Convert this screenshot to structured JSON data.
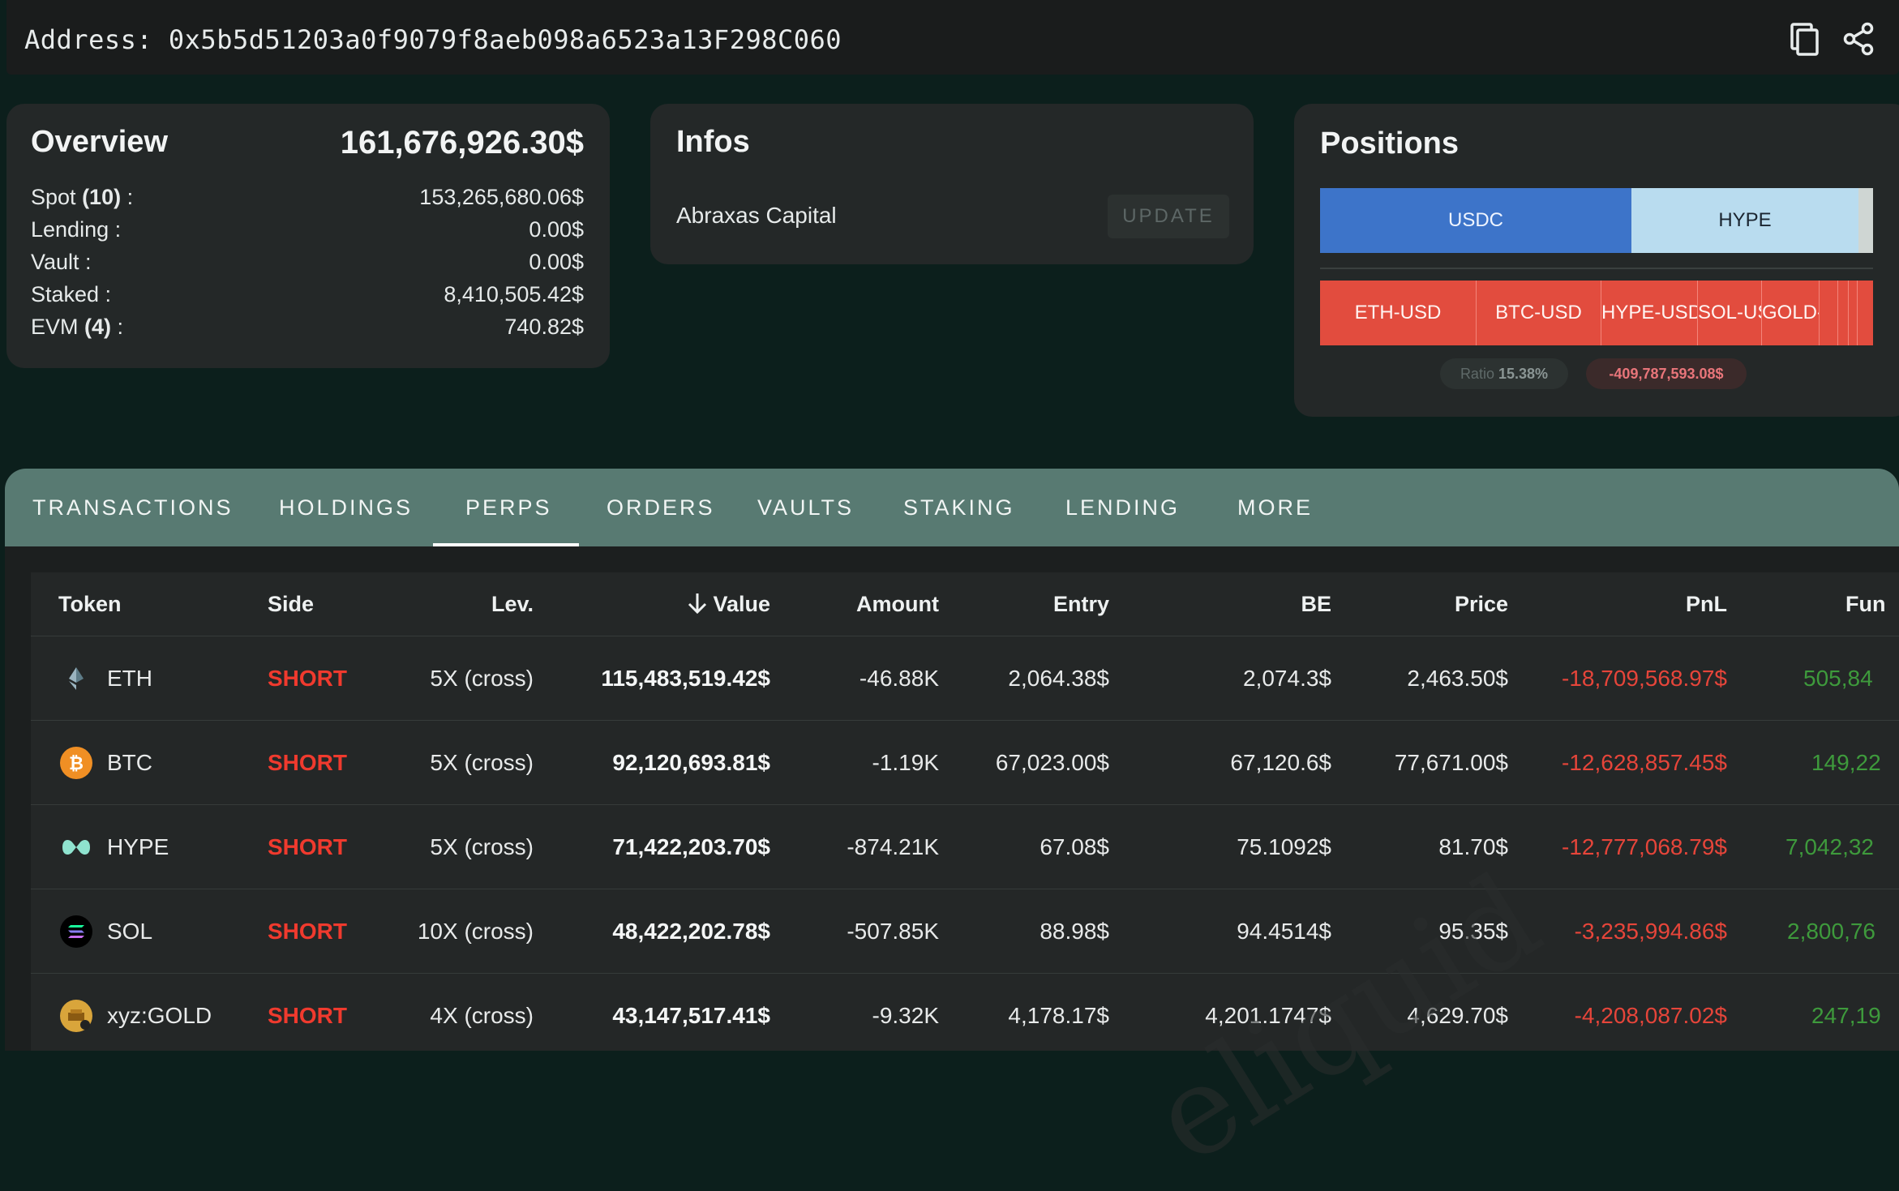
{
  "address": {
    "label": "Address: 0x5b5d51203a0f9079f8aeb098a6523a13F298C060",
    "copy_icon": "copy-icon",
    "share_icon": "share-icon"
  },
  "overview": {
    "title": "Overview",
    "total": "161,676,926.30$",
    "rows": [
      {
        "label": "Spot",
        "count": "(10)",
        "suffix": " :",
        "value": "153,265,680.06$"
      },
      {
        "label": "Lending :",
        "count": "",
        "suffix": "",
        "value": "0.00$"
      },
      {
        "label": "Vault :",
        "count": "",
        "suffix": "",
        "value": "0.00$"
      },
      {
        "label": "Staked :",
        "count": "",
        "suffix": "",
        "value": "8,410,505.42$"
      },
      {
        "label": "EVM",
        "count": "(4)",
        "suffix": " :",
        "value": "740.82$"
      }
    ]
  },
  "infos": {
    "title": "Infos",
    "name": "Abraxas Capital",
    "update_label": "UPDATE"
  },
  "positions": {
    "title": "Positions",
    "spot_bars": [
      {
        "label": "USDC"
      },
      {
        "label": "HYPE"
      },
      {
        "label": ""
      }
    ],
    "perp_bars": [
      {
        "label": "ETH-USD"
      },
      {
        "label": "BTC-USD"
      },
      {
        "label": "HYPE-USD"
      },
      {
        "label": "SOL-USD"
      },
      {
        "label": "GOLD-"
      },
      {
        "label": ""
      },
      {
        "label": ""
      },
      {
        "label": ""
      },
      {
        "label": ""
      }
    ],
    "ratio_label": "Ratio",
    "ratio_value": "15.38%",
    "pnl_total": "-409,787,593.08$"
  },
  "tabs": [
    {
      "label": "TRANSACTIONS",
      "active": false
    },
    {
      "label": "HOLDINGS",
      "active": false
    },
    {
      "label": "PERPS",
      "active": true
    },
    {
      "label": "ORDERS",
      "active": false
    },
    {
      "label": "VAULTS",
      "active": false
    },
    {
      "label": "STAKING",
      "active": false
    },
    {
      "label": "LENDING",
      "active": false
    },
    {
      "label": "MORE",
      "active": false
    }
  ],
  "table": {
    "headers": {
      "token": "Token",
      "side": "Side",
      "lev": "Lev.",
      "value": "Value",
      "amount": "Amount",
      "entry": "Entry",
      "be": "BE",
      "price": "Price",
      "pnl": "PnL",
      "funding": "Fun"
    },
    "sort_icon": "arrow-down-icon",
    "rows": [
      {
        "token": "ETH",
        "icon": "eth-icon",
        "side": "SHORT",
        "lev": "5X (cross)",
        "value": "115,483,519.42$",
        "amount": "-46.88K",
        "entry": "2,064.38$",
        "be": "2,074.3$",
        "price": "2,463.50$",
        "pnl": "-18,709,568.97$",
        "funding": "505,84"
      },
      {
        "token": "BTC",
        "icon": "btc-icon",
        "side": "SHORT",
        "lev": "5X (cross)",
        "value": "92,120,693.81$",
        "amount": "-1.19K",
        "entry": "67,023.00$",
        "be": "67,120.6$",
        "price": "77,671.00$",
        "pnl": "-12,628,857.45$",
        "funding": "149,22"
      },
      {
        "token": "HYPE",
        "icon": "hype-icon",
        "side": "SHORT",
        "lev": "5X (cross)",
        "value": "71,422,203.70$",
        "amount": "-874.21K",
        "entry": "67.08$",
        "be": "75.1092$",
        "price": "81.70$",
        "pnl": "-12,777,068.79$",
        "funding": "7,042,32"
      },
      {
        "token": "SOL",
        "icon": "sol-icon",
        "side": "SHORT",
        "lev": "10X (cross)",
        "value": "48,422,202.78$",
        "amount": "-507.85K",
        "entry": "88.98$",
        "be": "94.4514$",
        "price": "95.35$",
        "pnl": "-3,235,994.86$",
        "funding": "2,800,76"
      },
      {
        "token": "xyz:GOLD",
        "icon": "gold-icon",
        "side": "SHORT",
        "lev": "4X (cross)",
        "value": "43,147,517.41$",
        "amount": "-9.32K",
        "entry": "4,178.17$",
        "be": "4,201.1747$",
        "price": "4,629.70$",
        "pnl": "-4,208,087.02$",
        "funding": "247,19"
      }
    ]
  },
  "watermark": "eliquid"
}
